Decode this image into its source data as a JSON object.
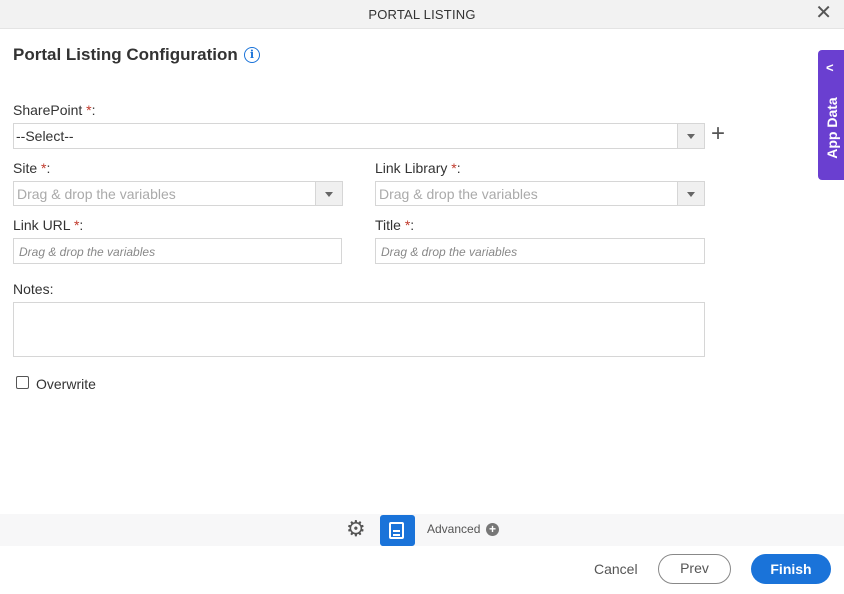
{
  "window": {
    "title": "PORTAL LISTING",
    "close_icon": "close-icon"
  },
  "heading": {
    "title": "Portal Listing Configuration",
    "info_icon": "i"
  },
  "fields": {
    "sharepoint": {
      "label": "SharePoint ",
      "required": "*",
      "colon": ":",
      "value": "--Select--"
    },
    "site": {
      "label": "Site ",
      "required": "*",
      "colon": ":",
      "placeholder": "Drag & drop the variables"
    },
    "link_library": {
      "label": "Link Library ",
      "required": "*",
      "colon": ":",
      "placeholder": "Drag & drop the variables"
    },
    "link_url": {
      "label": "Link URL ",
      "required": "*",
      "colon": ":",
      "placeholder": "Drag & drop the variables"
    },
    "title": {
      "label": "Title ",
      "required": "*",
      "colon": ":",
      "placeholder": "Drag & drop the variables"
    },
    "notes": {
      "label": "Notes:",
      "value": ""
    },
    "overwrite": {
      "label": "Overwrite",
      "checked": false
    }
  },
  "add_icon": "+",
  "side_panel": {
    "label": "App Data",
    "chevron": "<"
  },
  "toolbar": {
    "advanced_label": "Advanced",
    "advanced_plus": "+"
  },
  "footer": {
    "cancel": "Cancel",
    "prev": "Prev",
    "finish": "Finish"
  }
}
